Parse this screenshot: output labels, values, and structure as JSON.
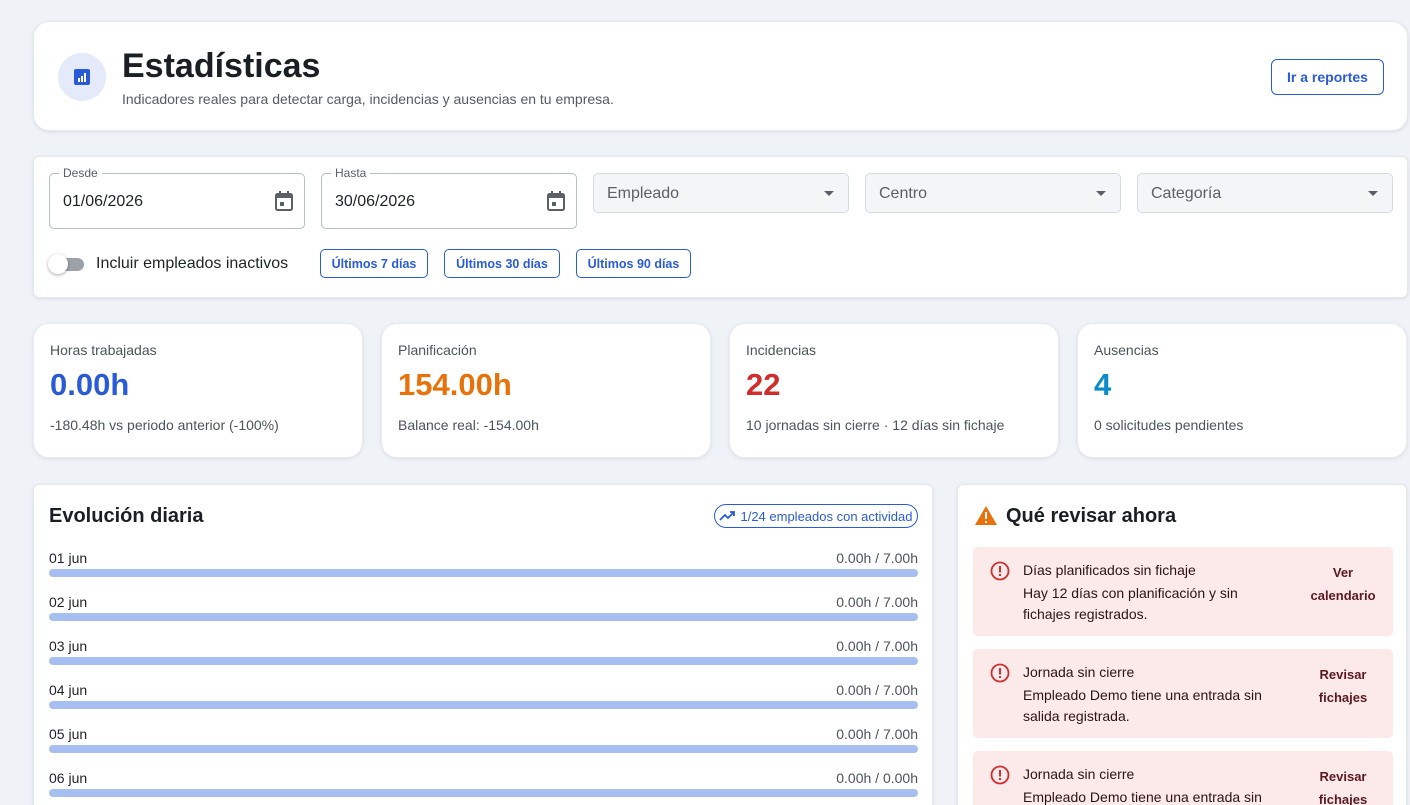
{
  "header": {
    "icon": "bar-chart-icon",
    "title": "Estadísticas",
    "subtitle": "Indicadores reales para detectar carga, incidencias y ausencias en tu empresa.",
    "reports_button": "Ir a reportes"
  },
  "filters": {
    "from": {
      "label": "Desde",
      "value": "01/06/2026"
    },
    "to": {
      "label": "Hasta",
      "value": "30/06/2026"
    },
    "employee_placeholder": "Empleado",
    "center_placeholder": "Centro",
    "category_placeholder": "Categoría",
    "include_inactive": {
      "label": "Incluir empleados inactivos",
      "checked": false
    },
    "quick_ranges": [
      "Últimos 7 días",
      "Últimos 30 días",
      "Últimos 90 días"
    ]
  },
  "kpis": [
    {
      "label": "Horas trabajadas",
      "value": "0.00h",
      "sub": "-180.48h vs periodo anterior (-100%)",
      "color": "#2a5bd7"
    },
    {
      "label": "Planificación",
      "value": "154.00h",
      "sub": "Balance real: -154.00h",
      "color": "#e8710a"
    },
    {
      "label": "Incidencias",
      "value": "22",
      "sub": "10 jornadas sin cierre · 12 días sin fichaje",
      "color": "#d12d2d"
    },
    {
      "label": "Ausencias",
      "value": "4",
      "sub": "0 solicitudes pendientes",
      "color": "#0b8bc9"
    }
  ],
  "evolution": {
    "title": "Evolución diaria",
    "activity_badge": "1/24 empleados con actividad",
    "days": [
      {
        "label": "01 jun",
        "value": "0.00h / 7.00h",
        "progress": 0
      },
      {
        "label": "02 jun",
        "value": "0.00h / 7.00h",
        "progress": 0
      },
      {
        "label": "03 jun",
        "value": "0.00h / 7.00h",
        "progress": 0
      },
      {
        "label": "04 jun",
        "value": "0.00h / 7.00h",
        "progress": 0
      },
      {
        "label": "05 jun",
        "value": "0.00h / 7.00h",
        "progress": 0
      },
      {
        "label": "06 jun",
        "value": "0.00h / 0.00h",
        "progress": 0
      }
    ]
  },
  "review": {
    "title": "Qué revisar ahora",
    "icon": "warning-icon",
    "alerts": [
      {
        "title": "Días planificados sin fichaje",
        "message": "Hay 12 días con planificación y sin fichajes registrados.",
        "action": "Ver calendario"
      },
      {
        "title": "Jornada sin cierre",
        "message": "Empleado Demo tiene una entrada sin salida registrada.",
        "action": "Revisar fichajes"
      },
      {
        "title": "Jornada sin cierre",
        "message": "Empleado Demo tiene una entrada sin salida registrada.",
        "action": "Revisar fichajes"
      }
    ]
  },
  "colors": {
    "accent": "#2a5bd7",
    "alert_bg": "#fce9ea",
    "alert_icon": "#d12d2d",
    "warning": "#e8710a"
  }
}
